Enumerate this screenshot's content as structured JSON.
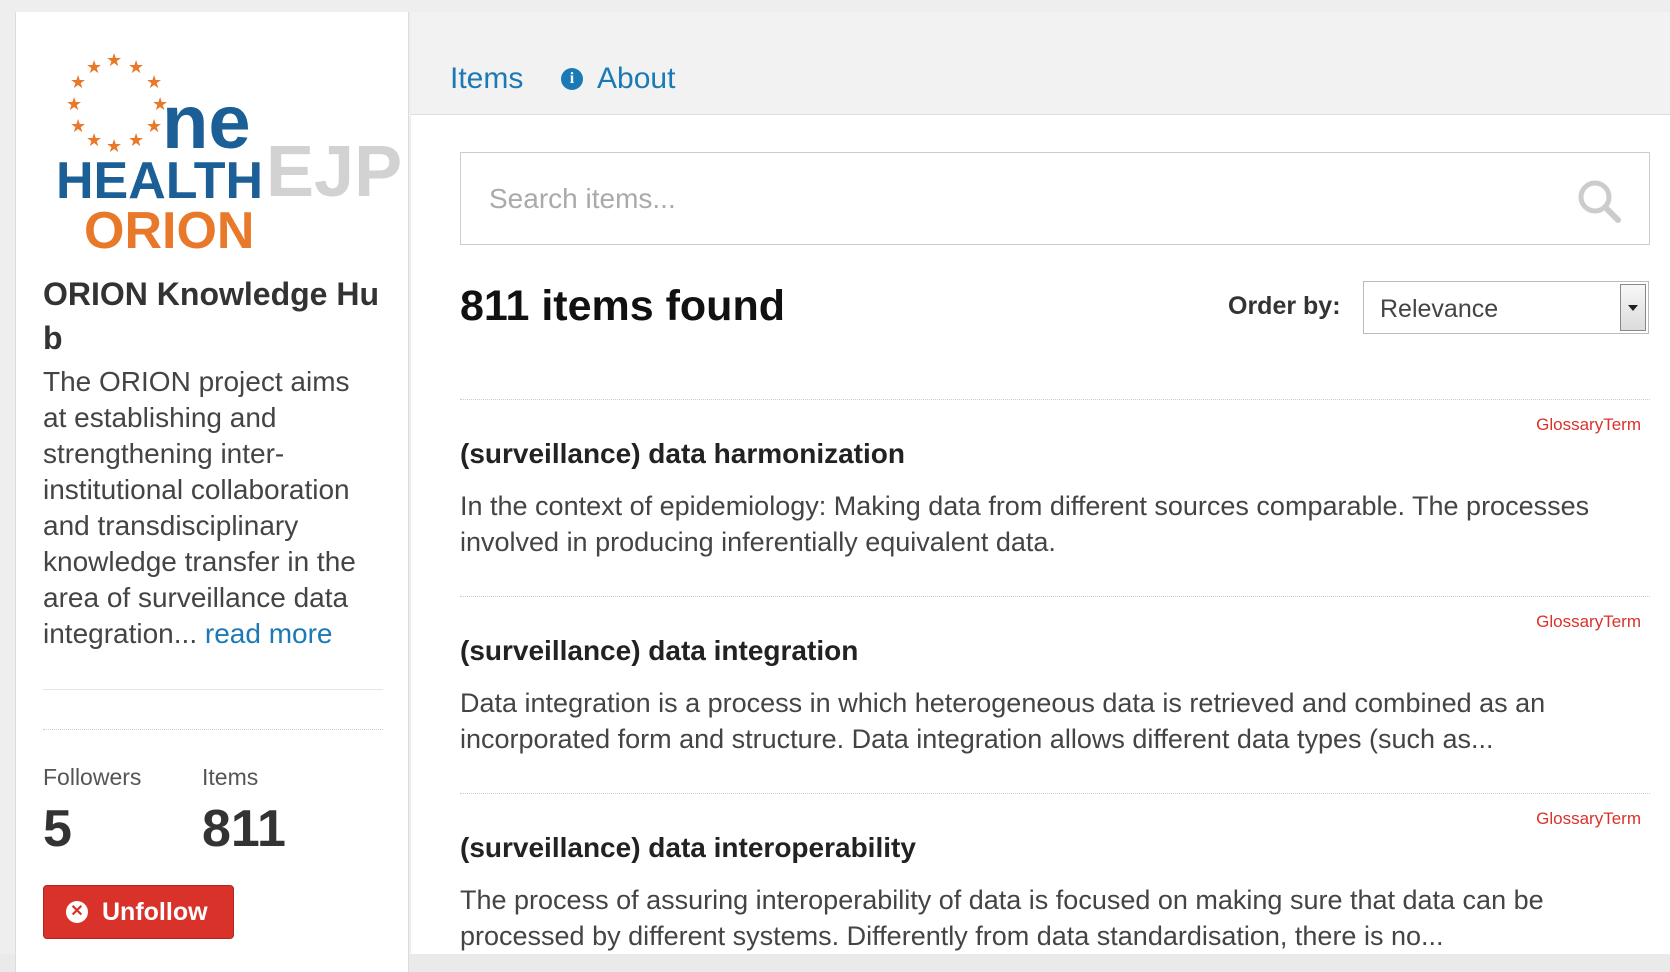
{
  "sidebar": {
    "logo": {
      "text_ne": "ne",
      "text_health": "HEALTH",
      "text_ejp": "EJP",
      "text_orion": "ORION"
    },
    "title": "ORION Knowledge Hub",
    "description": "The ORION project aims at establishing and strengthening inter-institutional collaboration and transdisciplinary knowledge transfer in the area of surveillance data integration...",
    "read_more": "read more",
    "followers_label": "Followers",
    "followers_value": "5",
    "items_label": "Items",
    "items_value": "811",
    "unfollow_label": "Unfollow"
  },
  "nav": {
    "items_label": "Items",
    "about_label": "About"
  },
  "search": {
    "placeholder": "Search items..."
  },
  "results": {
    "count_text": "811 items found",
    "order_label": "Order by:",
    "order_value": "Relevance",
    "items": [
      {
        "badge": "GlossaryTerm",
        "title": "(surveillance) data harmonization",
        "description": "In the context of epidemiology: Making data from different sources comparable. The processes involved in producing inferentially equivalent data."
      },
      {
        "badge": "GlossaryTerm",
        "title": "(surveillance) data integration",
        "description": "Data integration is a process in which heterogeneous data is retrieved and combined as an incorporated form and structure. Data integration allows different data types (such as..."
      },
      {
        "badge": "GlossaryTerm",
        "title": "(surveillance) data interoperability",
        "description": "The process of assuring interoperability of data is focused on making sure that data can be processed by different systems. Differently from data standardisation, there is no..."
      }
    ]
  },
  "colors": {
    "link": "#1b7ab5",
    "accent_orange": "#e8782a",
    "logo_blue": "#1b5f96",
    "danger": "#d9322b"
  }
}
